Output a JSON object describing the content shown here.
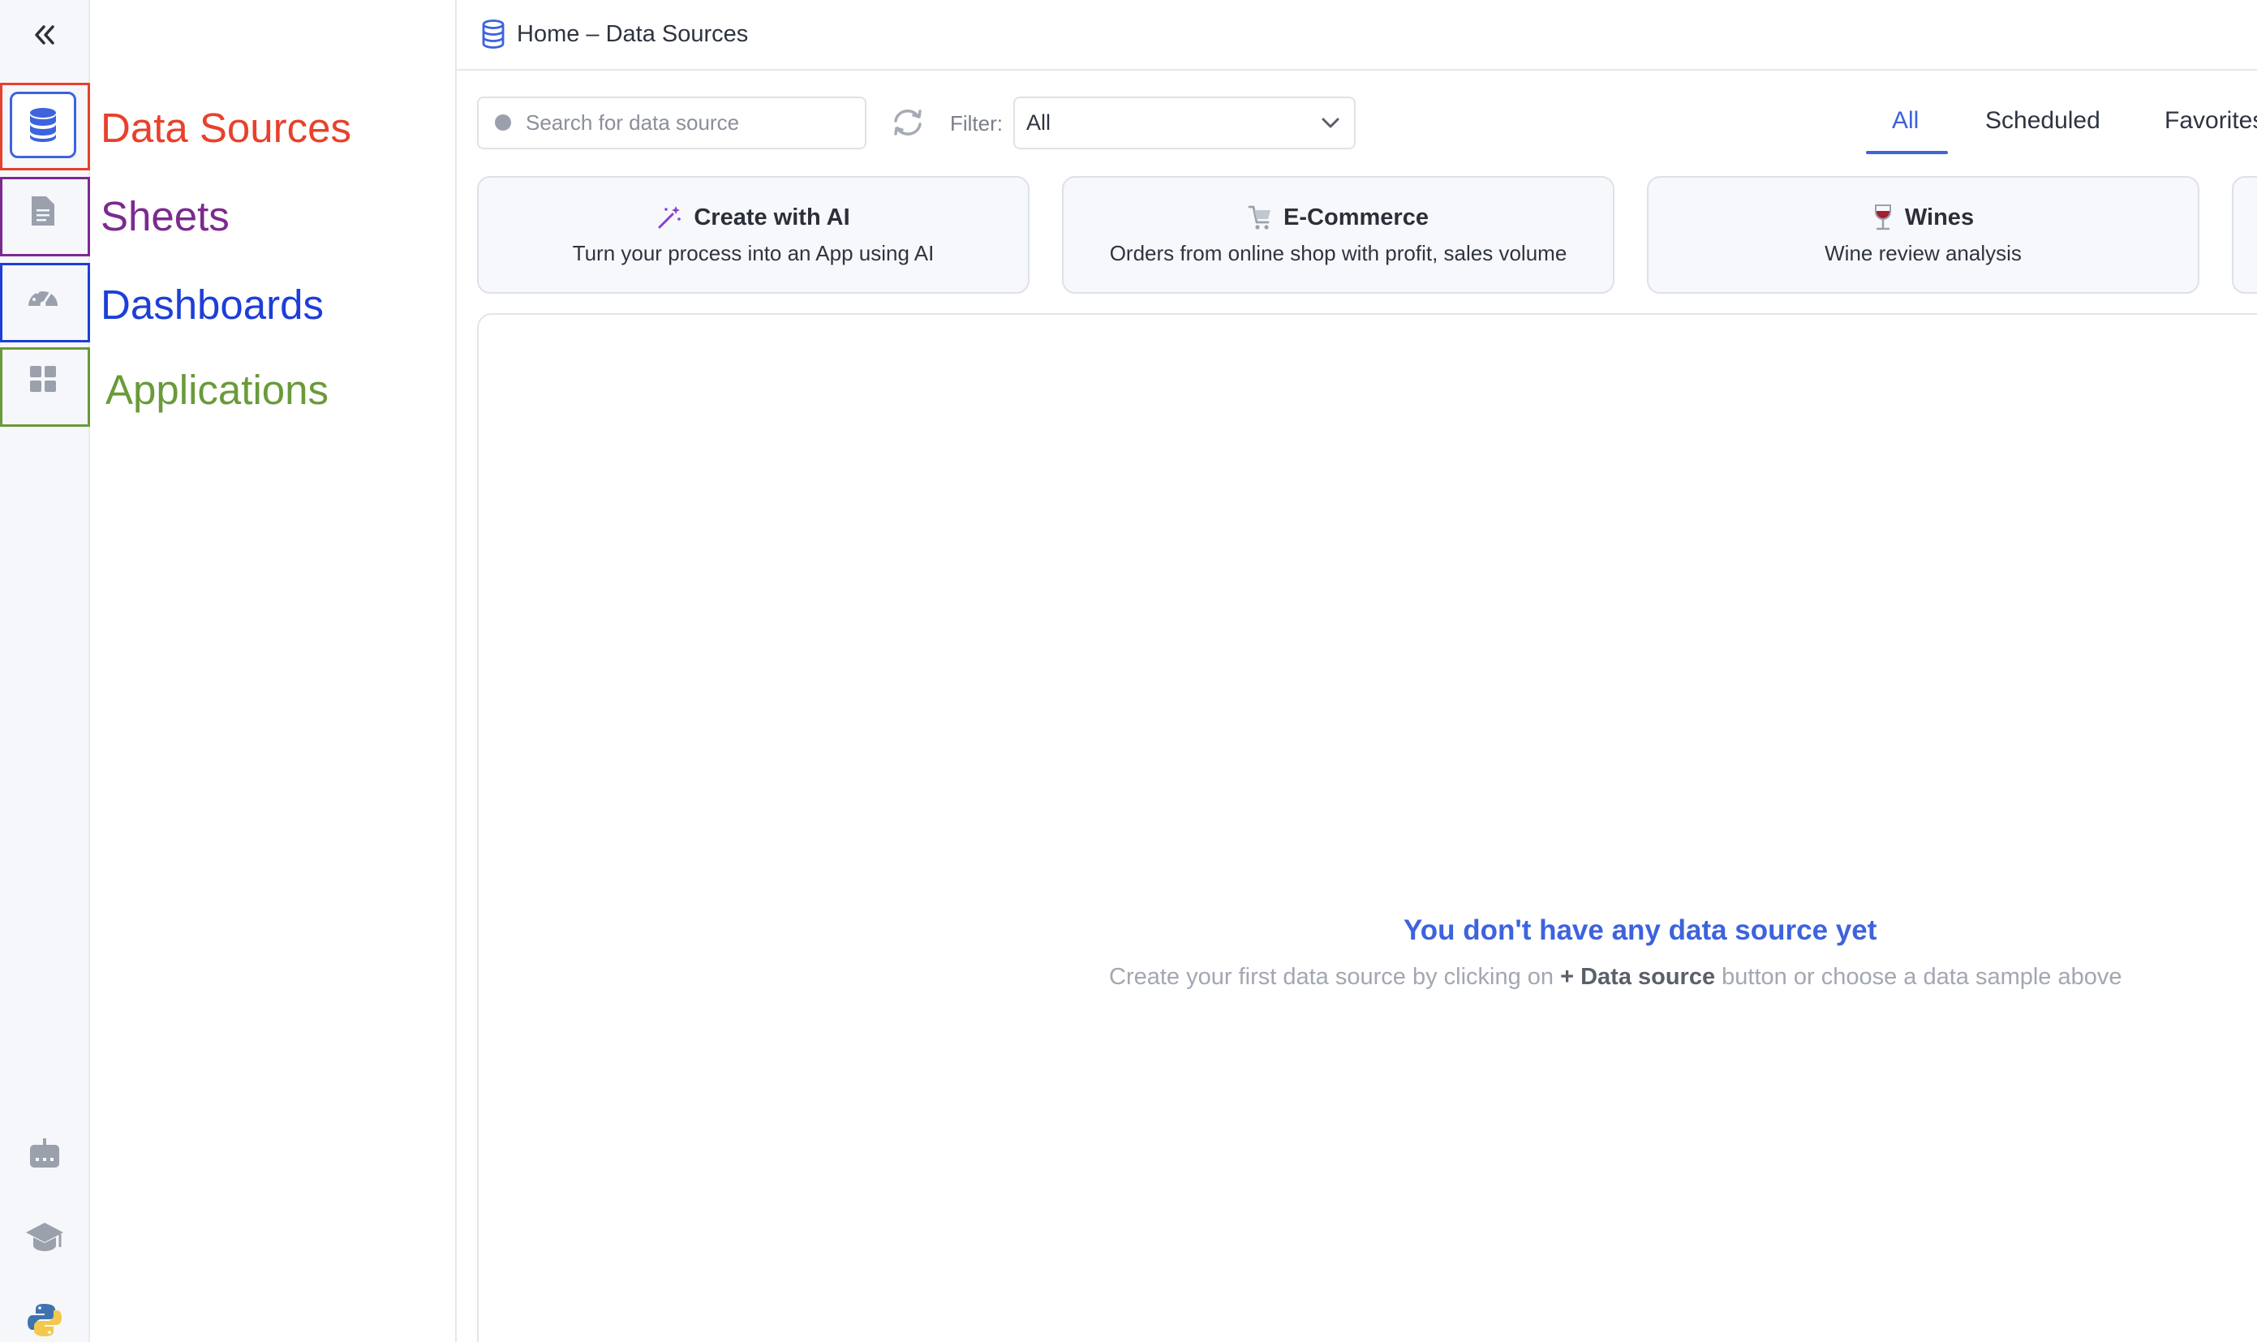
{
  "header": {
    "breadcrumb": "Home – Data Sources"
  },
  "sidebar_labels": {
    "data_sources": "Data Sources",
    "sheets": "Sheets",
    "dashboards": "Dashboards",
    "applications": "Applications"
  },
  "sidebar_icons": {
    "collapse": "double-chevron-left-icon",
    "data_sources": "database-icon",
    "sheets": "document-icon",
    "dashboards": "gauge-icon",
    "applications": "grid-icon",
    "bottom": [
      "robot-icon",
      "graduation-cap-icon",
      "python-icon"
    ]
  },
  "toolbar": {
    "search_placeholder": "Search for data source",
    "filter_label": "Filter:",
    "filter_value": "All"
  },
  "tabs": [
    {
      "label": "All",
      "active": true
    },
    {
      "label": "Scheduled",
      "active": false
    },
    {
      "label": "Favorites",
      "active": false
    }
  ],
  "samples": [
    {
      "title": "Create with AI",
      "desc": "Turn your process into an App using AI",
      "icon": "magic-wand-icon"
    },
    {
      "title": "E-Commerce",
      "desc": "Orders from online shop with profit, sales volume",
      "icon": "shopping-cart-icon"
    },
    {
      "title": "Wines",
      "desc": "Wine review analysis",
      "icon": "wine-glass-icon"
    }
  ],
  "empty_state": {
    "title": "You don't have any data source yet",
    "sub_before": "Create your first data source by clicking on ",
    "sub_bold": "+ Data source",
    "sub_after": " button or choose a data sample above"
  },
  "colors": {
    "accent": "#3d63dd",
    "annot_data_sources": "#e8412c",
    "annot_sheets": "#7b2a8f",
    "annot_dashboards": "#1d3ed8",
    "annot_applications": "#6a9a3a"
  }
}
